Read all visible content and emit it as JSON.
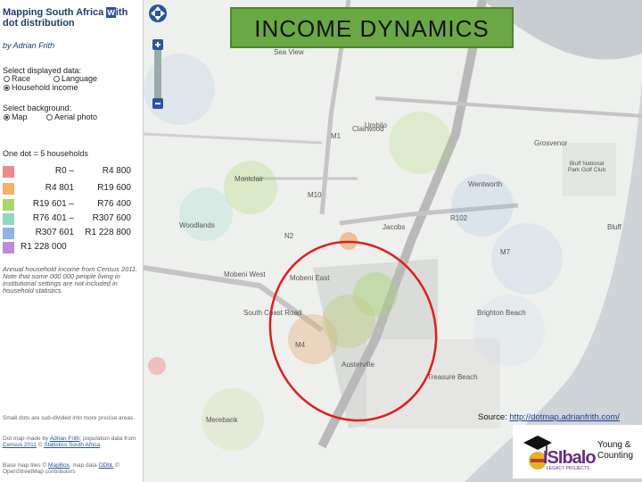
{
  "sidebar": {
    "title_part1": "Mapping South Africa ",
    "title_w": "w",
    "title_part2": "ith dot distribution",
    "author": "by Adrian Frith",
    "select_data_label": "Select displayed data:",
    "data_options": [
      {
        "label": "Race",
        "selected": false
      },
      {
        "label": "Language",
        "selected": false
      },
      {
        "label": "Household income",
        "selected": true
      }
    ],
    "select_background_label": "Select background:",
    "background_options": [
      {
        "label": "Map",
        "selected": true
      },
      {
        "label": "Aerial photo",
        "selected": false
      }
    ],
    "dot_info": "One dot = 5 households",
    "legend": [
      {
        "low": "R0 –",
        "high": "R4 800",
        "color": "#f08a8a"
      },
      {
        "low": "R4 801",
        "high": "R19 600",
        "color": "#f5b06a"
      },
      {
        "low": "R19 601 –",
        "high": "R76 400",
        "color": "#a6d86a"
      },
      {
        "low": "R76 401 –",
        "high": "R307 600",
        "color": "#8fd8c3"
      },
      {
        "low": "R307 601",
        "high": "R1 228 800",
        "color": "#8fb3e3"
      },
      {
        "low": "R1 228 000",
        "high": "",
        "color": "#c08ad8"
      }
    ],
    "note": "Annual household income from Census 2011. Note that some 000 000 people living in institutional settings are not included in household statistics.",
    "foot1": "Small dots are sub-divided into more precise areas.",
    "foot2_prefix": "Dot map made by ",
    "foot2_author": "Adrian Frith",
    "foot2_mid": "; population data from ",
    "foot2_census": "Census 2011",
    "foot2_sep": " © ",
    "foot2_stats": "Statistics South Africa",
    "foot3_prefix": "Base map tiles © ",
    "foot3_mapbox": "MapBox",
    "foot3_mid": ", map data ",
    "foot3_odbl": "ODbL",
    "foot3_end": " © OpenStreetMap contributors"
  },
  "title": "INCOME DYNAMICS",
  "source_label": "Source: ",
  "source_url": "http://dotmap.adrianfrith.com/",
  "logo": {
    "brand": "ISIbalo",
    "tagline": "LEGACY PROJECTS",
    "line1": "Young &",
    "line2": "Counting"
  },
  "map_labels": [
    "Sea View",
    "Umbilo",
    "Montclair",
    "Woodlands",
    "Jacobs",
    "Wentworth",
    "Bluff National Park Golf Club",
    "Mobeni West",
    "Mobeni East",
    "Brighton Beach",
    "Austerville",
    "Treasure Beach",
    "Merebank",
    "Grosvenor",
    "Clairwood",
    "Bluff",
    "M4",
    "M7",
    "M10",
    "M1",
    "N2",
    "R102",
    "South Coast Road"
  ]
}
